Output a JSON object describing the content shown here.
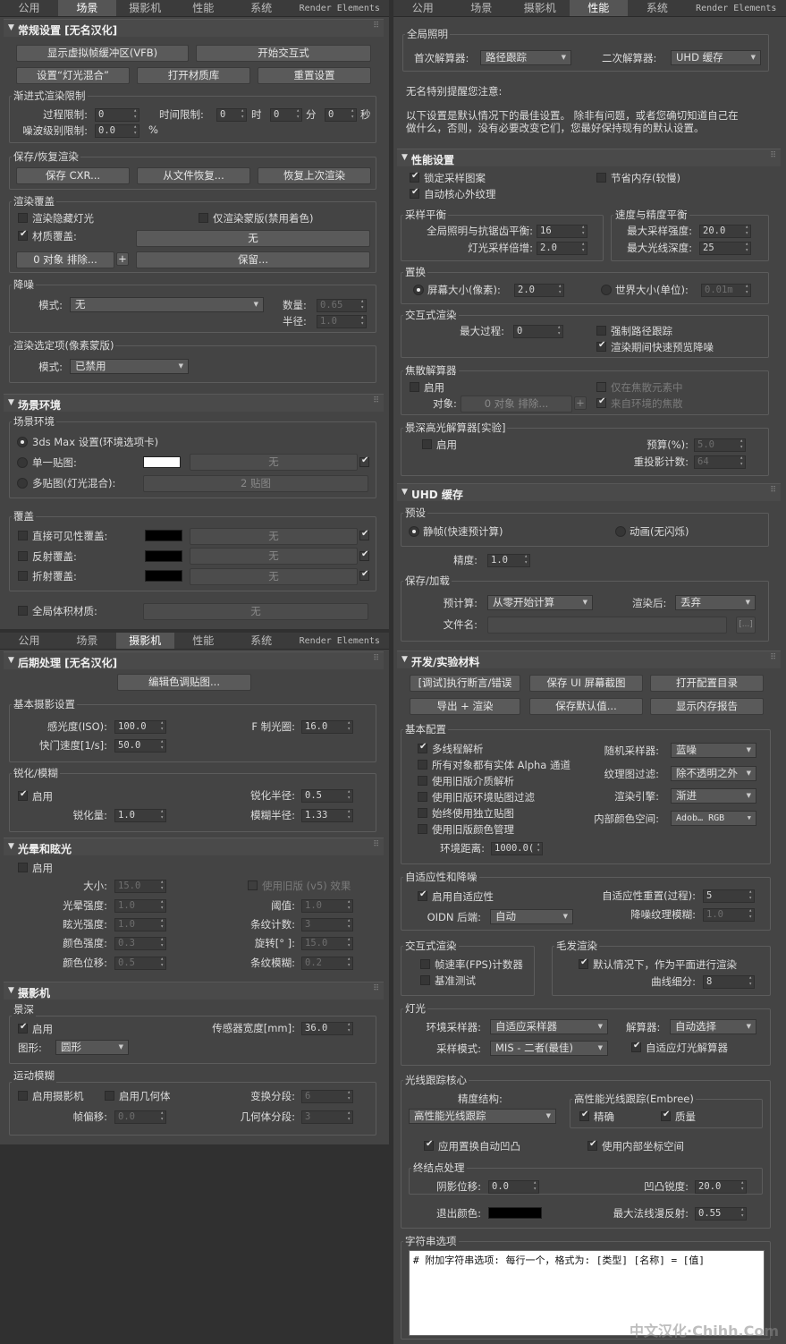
{
  "tab_labels": [
    "公用",
    "场景",
    "摄影机",
    "性能",
    "系统",
    "Render Elements"
  ],
  "tl": {
    "common": {
      "title": "常规设置 [无名汉化]",
      "btn_vfb": "显示虚拟帧缓冲区(VFB)",
      "btn_interactive": "开始交互式",
      "btn_lightmix": "设置“灯光混合”",
      "btn_matlib": "打开材质库",
      "btn_reset": "重置设置",
      "prog_group": "渐进式渲染限制",
      "pass_limit_label": "过程限制:",
      "pass_limit": "0",
      "time_limit_label": "时间限制:",
      "time_h": "0",
      "h": "时",
      "time_m": "0",
      "m": "分",
      "time_s": "0",
      "s": "秒",
      "noise_label": "噪波级别限制:",
      "noise": "0.0",
      "pct": "%",
      "save_group": "保存/恢复渲染",
      "btn_save": "保存 CXR...",
      "btn_restore_file": "从文件恢复...",
      "btn_restore_last": "恢复上次渲染",
      "override_group": "渲染覆盖",
      "render_hidden": "渲染隐藏灯光",
      "mask_only": "仅渲染蒙版(禁用着色)",
      "mat_override": "材质覆盖:",
      "mat_none": "无",
      "excl_btn": "0 对象 排除...",
      "plus": "+",
      "keep_btn": "保留...",
      "denoise_group": "降噪",
      "mode_label": "模式:",
      "mode_value": "无",
      "amount_label": "数量:",
      "amount": "0.65",
      "radius_label": "半径:",
      "radius": "1.0",
      "sel_group": "渲染选定项(像素蒙版)",
      "sel_mode_label": "模式:",
      "sel_mode": "已禁用"
    },
    "scene": {
      "title": "场景环境",
      "env_group": "场景环境",
      "opt_3ds": "3ds Max 设置(环境选项卡)",
      "opt_single": "单一贴图:",
      "opt_multi": "多贴图(灯光混合):",
      "none1": "无",
      "multi_btn": "2 贴图",
      "ovr_group": "覆盖",
      "direct": "直接可见性覆盖:",
      "refl": "反射覆盖:",
      "refr": "折射覆盖:",
      "none2": "无",
      "none3": "无",
      "none4": "无",
      "global_vol": "全局体积材质:",
      "none5": "无"
    }
  },
  "bl": {
    "post": {
      "title": "后期处理 [无名汉化]",
      "btn_edit": "编辑色调贴图...",
      "basic_group": "基本摄影设置",
      "iso_label": "感光度(ISO):",
      "iso": "100.0",
      "f_label": "F 制光圈:",
      "f": "16.0",
      "shutter_label": "快门速度[1/s]:",
      "shutter": "50.0",
      "sharp_group": "锐化/模糊",
      "enable": "启用",
      "sharp_radius_label": "锐化半径:",
      "sharp_radius": "0.5",
      "sharp_amount_label": "锐化量:",
      "sharp_amount": "1.0",
      "blur_radius_label": "模糊半径:",
      "blur_radius": "1.33"
    },
    "bloom": {
      "title": "光晕和眩光",
      "enable": "启用",
      "size_label": "大小:",
      "size": "15.0",
      "legacy": "使用旧版 (v5) 效果",
      "bloom_label": "光晕强度:",
      "bloom": "1.0",
      "thr_label": "阈值:",
      "thr": "1.0",
      "glare_label": "眩光强度:",
      "glare": "1.0",
      "streak_label": "条纹计数:",
      "streak": "3",
      "tint_label": "颜色强度:",
      "tint": "0.3",
      "rot_label": "旋转[° ]:",
      "rot": "15.0",
      "shift_label": "颜色位移:",
      "shift": "0.5",
      "sblur_label": "条纹模糊:",
      "sblur": "0.2"
    },
    "camera": {
      "title": "摄影机",
      "dof_group": "景深",
      "enable": "启用",
      "sensor_label": "传感器宽度[mm]:",
      "sensor": "36.0",
      "shape_label": "图形:",
      "shape": "圆形",
      "mb_group": "运动模糊",
      "mb_cam": "启用摄影机",
      "mb_geo": "启用几何体",
      "trans_label": "变换分段:",
      "trans": "6",
      "offset_label": "帧偏移:",
      "offset": "0.0",
      "geo_label": "几何体分段:",
      "geo": "3"
    }
  },
  "rt": {
    "gi": {
      "group": "全局照明",
      "primary_label": "首次解算器:",
      "primary": "路径跟踪",
      "secondary_label": "二次解算器:",
      "secondary": "UHD 缓存",
      "note_title": "无名特别提醒您注意:",
      "note1": "以下设置是默认情况下的最佳设置。 除非有问题，或者您确切知道自己在",
      "note2": "做什么，否则，没有必要改变它们，您最好保持现有的默认设置。"
    },
    "perf": {
      "title": "性能设置",
      "lock": "锁定采样图案",
      "save_mem": "节省内存(较慢)",
      "auto_core": "自动核心外纹理",
      "bal_group": "采样平衡",
      "gi_aa_label": "全局照明与抗锯齿平衡:",
      "gi_aa": "16",
      "light_mul_label": "灯光采样倍增:",
      "light_mul": "2.0",
      "sp_group": "速度与精度平衡",
      "max_int_label": "最大采样强度:",
      "max_int": "20.0",
      "max_depth_label": "最大光线深度:",
      "max_depth": "25",
      "disp_group": "置换",
      "screen": "屏幕大小(像素):",
      "screen_v": "2.0",
      "world": "世界大小(单位):",
      "world_v": "0.01m",
      "ir_group": "交互式渲染",
      "max_pass_label": "最大过程:",
      "max_pass": "0",
      "force_path": "强制路径跟踪",
      "fast_denoise": "渲染期间快速预览降噪",
      "caustic_group": "焦散解算器",
      "enable": "启用",
      "caustic_only": "仅在焦散元素中",
      "obj_label": "对象:",
      "obj_btn": "0 对象 排除...",
      "plus": "+",
      "from_env": "来自环境的焦散",
      "dof_group": "景深高光解算器[实验]",
      "enable2": "启用",
      "budget_label": "预算(%):",
      "budget": "5.0",
      "reuse_label": "重投影计数:",
      "reuse": "64"
    },
    "uhd": {
      "title": "UHD 缓存",
      "preset_group": "预设",
      "static": "静帧(快速预计算)",
      "anim": "动画(无闪烁)",
      "prec_label": "精度:",
      "prec": "1.0",
      "sl_group": "保存/加载",
      "precalc_label": "预计算:",
      "precalc": "从零开始计算",
      "after_label": "渲染后:",
      "after": "丢弃",
      "file_label": "文件名:",
      "browse": "[...]"
    },
    "dev": {
      "title": "开发/实验材料",
      "btn_assert": "[调试]执行断言/错误",
      "btn_save_ui": "保存 UI 屏幕截图",
      "btn_open_cfg": "打开配置目录",
      "btn_export": "导出 + 渲染",
      "btn_save_def": "保存默认值...",
      "btn_mem": "显示内存报告",
      "base_group": "基本配置",
      "mt": "多线程解析",
      "alpha": "所有对象都有实体 Alpha 通道",
      "legacy_med": "使用旧版介质解析",
      "legacy_env": "使用旧版环境贴图过滤",
      "indep": "始终使用独立贴图",
      "legacy_col": "使用旧版颜色管理",
      "env_dist_label": "环境距离:",
      "env_dist": "1000.0(",
      "rnd_label": "随机采样器:",
      "rnd": "蓝噪",
      "tex_label": "纹理图过滤:",
      "tex": "除不透明之外",
      "engine_label": "渲染引擎:",
      "engine": "渐进",
      "cs_label": "内部颜色空间:",
      "cs": "Adob… RGB",
      "ad_group": "自适应性和降噪",
      "ad_enable": "启用自适应性",
      "reset_label": "自适应性重置(过程):",
      "reset": "5",
      "oidn_label": "OIDN 后端:",
      "oidn": "自动",
      "blur_label": "降噪纹理模糊:",
      "blur": "1.0",
      "int_group": "交互式渲染",
      "fps": "帧速率(FPS)计数器",
      "bench": "基准测试",
      "hair_group": "毛发渲染",
      "hair_flat": "默认情况下，作为平面进行渲染",
      "curve_label": "曲线细分:",
      "curve": "8",
      "light_group": "灯光",
      "env_samp_label": "环境采样器:",
      "env_samp": "自适应采样器",
      "solver_label": "解算器:",
      "solver": "自动选择",
      "samp_mode_label": "采样模式:",
      "samp_mode": "MIS - 二者(最佳)",
      "adaptive_light": "自适应灯光解算器",
      "rt_group": "光线跟踪核心",
      "prec_struct_label": "精度结构:",
      "prec_struct": "高性能光线跟踪",
      "embree_group": "高性能光线跟踪(Embree)",
      "precise": "精确",
      "quality": "质量",
      "auto_bump": "应用置换自动凹凸",
      "internal_coords": "使用内部坐标空间",
      "end_group": "终结点处理",
      "shadow_label": "阴影位移:",
      "shadow": "0.0",
      "bump_label": "凹凸锐度:",
      "bump": "20.0",
      "exit_label": "退出颜色:",
      "max_refl_label": "最大法线漫反射:",
      "max_refl": "0.55",
      "str_group": "字符串选项",
      "str_text": "# 附加字符串选项: 每行一个，格式为: [类型] [名称] = [值]"
    }
  },
  "watermark": "中文汉化·Chihh.Com",
  "colors": {
    "panel": "#444444",
    "white_swatch": "#ffffff",
    "black_swatch": "#000000"
  }
}
